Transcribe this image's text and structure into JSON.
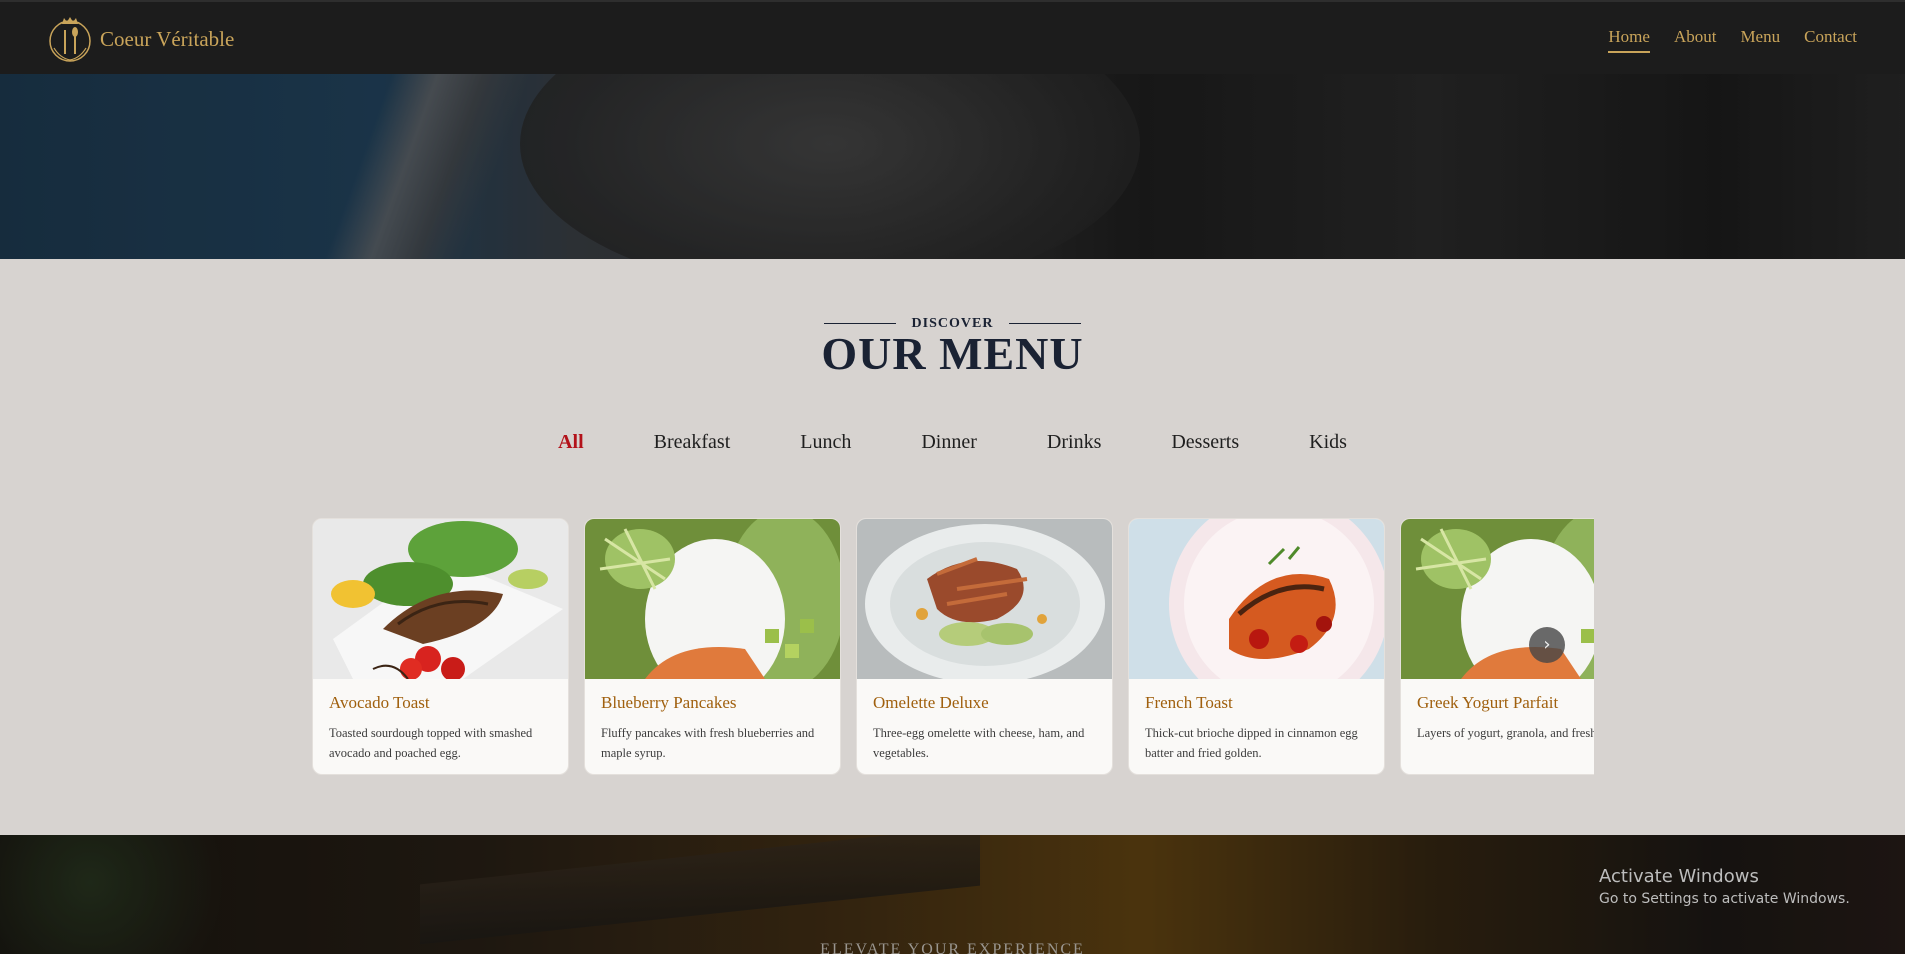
{
  "brand": {
    "name": "Coeur Véritable",
    "logo_icon": "crown-cutlery-icon",
    "accent": "#c9a45a"
  },
  "nav": {
    "links": [
      {
        "label": "Home",
        "active": true
      },
      {
        "label": "About",
        "active": false
      },
      {
        "label": "Menu",
        "active": false
      },
      {
        "label": "Contact",
        "active": false
      }
    ]
  },
  "menu": {
    "eyebrow": "DISCOVER",
    "title": "OUR MENU",
    "tabs": [
      "All",
      "Breakfast",
      "Lunch",
      "Dinner",
      "Drinks",
      "Desserts",
      "Kids"
    ],
    "active_tab": "All",
    "active_color": "#b3121a",
    "items": [
      {
        "name": "Avocado Toast",
        "desc": "Toasted sourdough topped with smashed avocado and poached egg."
      },
      {
        "name": "Blueberry Pancakes",
        "desc": "Fluffy pancakes with fresh blueberries and maple syrup."
      },
      {
        "name": "Omelette Deluxe",
        "desc": "Three-egg omelette with cheese, ham, and vegetables."
      },
      {
        "name": "French Toast",
        "desc": "Thick-cut brioche dipped in cinnamon egg batter and fried golden."
      },
      {
        "name": "Greek Yogurt Parfait",
        "desc": "Layers of yogurt, granola, and fresh berries."
      }
    ],
    "next_icon": "chevron-right-icon"
  },
  "banner": {
    "kicker": "ELEVATE YOUR EXPERIENCE"
  },
  "windows_watermark": {
    "line1": "Activate Windows",
    "line2": "Go to Settings to activate Windows."
  }
}
